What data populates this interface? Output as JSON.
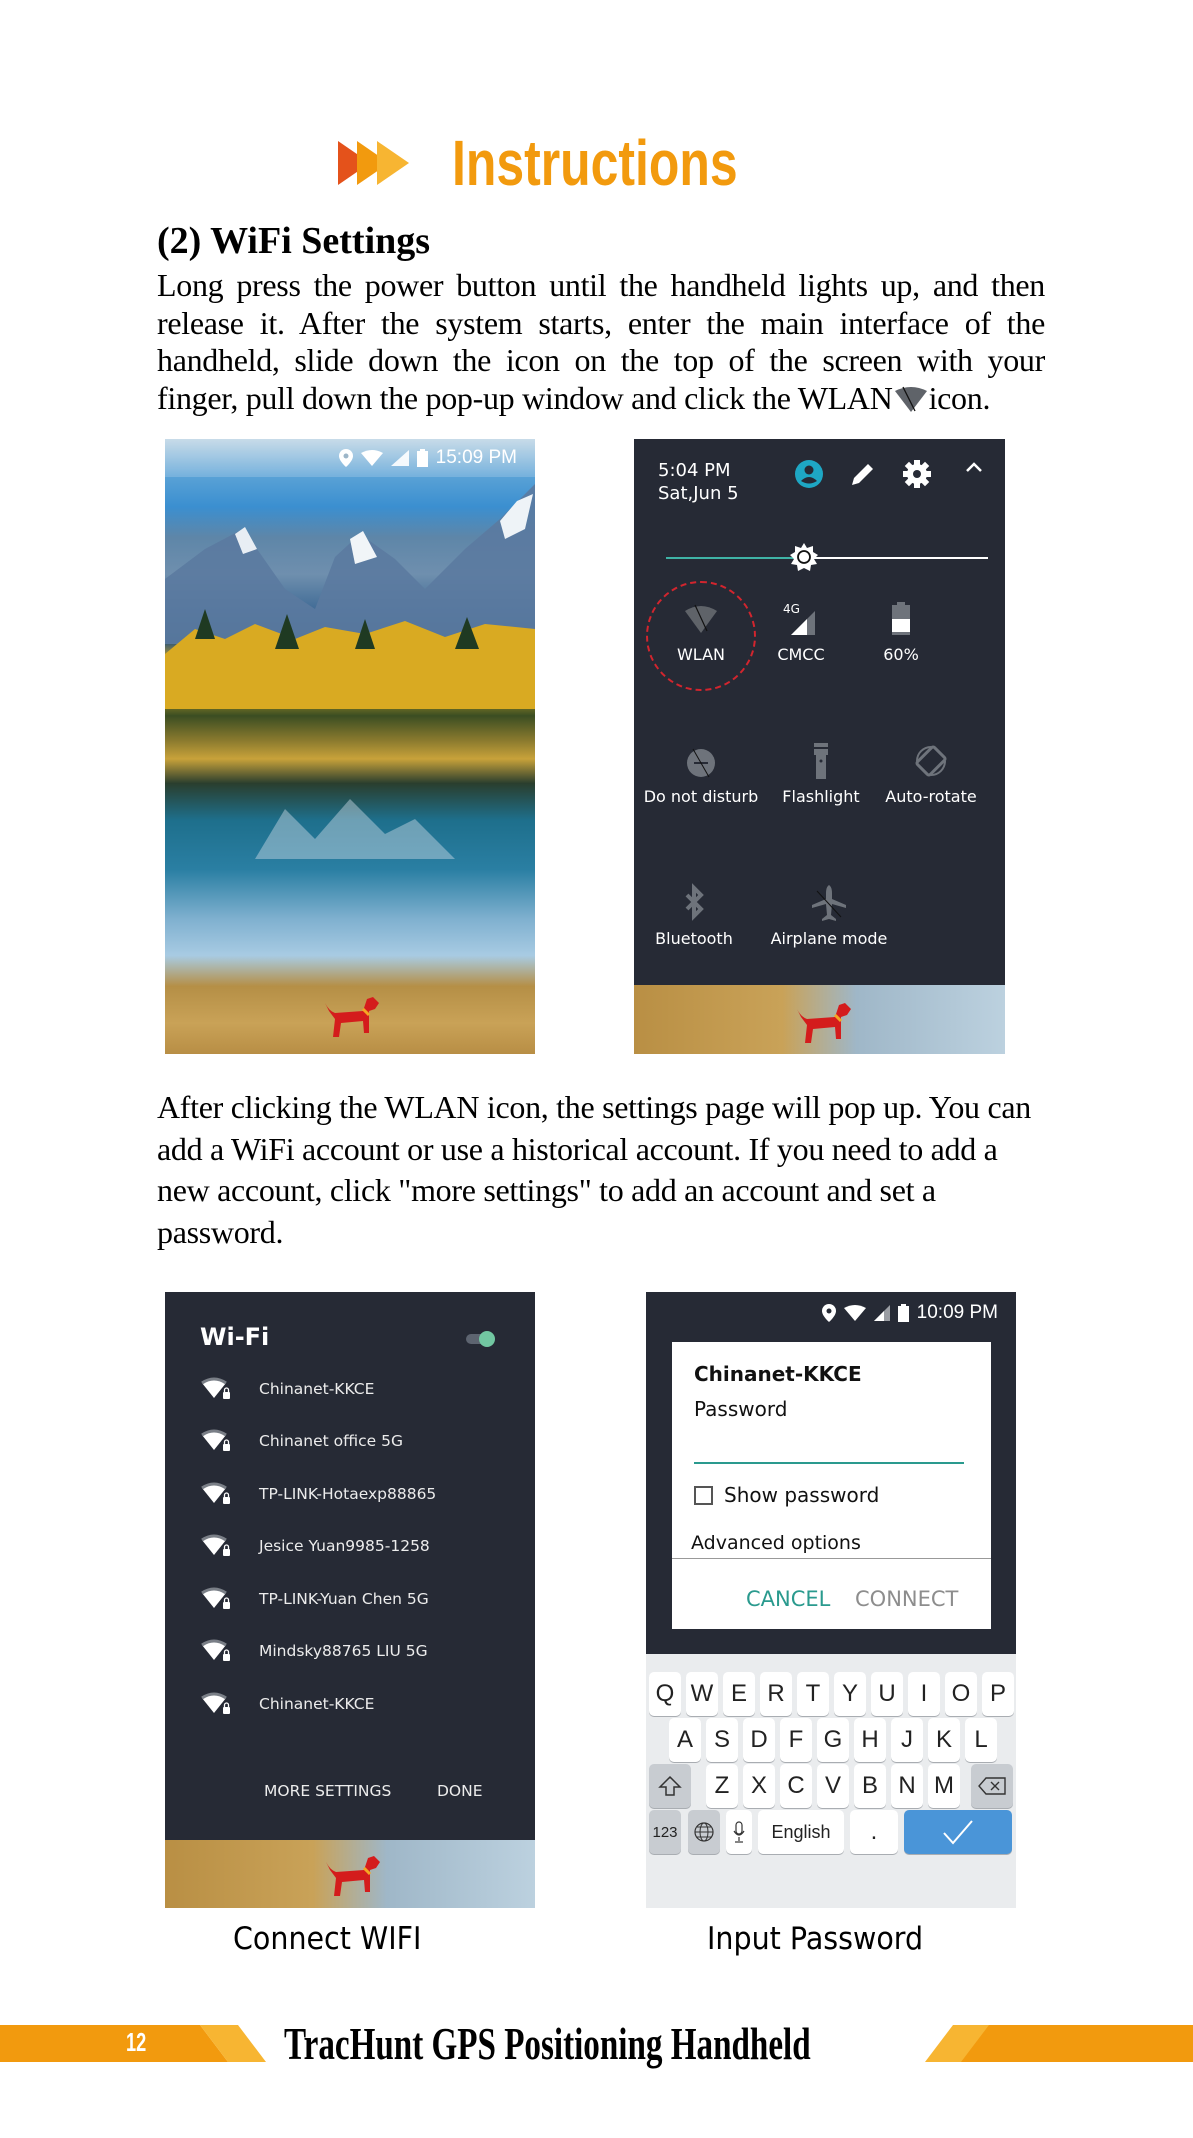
{
  "header": {
    "title": "Instructions",
    "arrow_colors": [
      "#e4521b",
      "#f29a0e",
      "#f7b532"
    ]
  },
  "section": {
    "heading": "(2) WiFi Settings",
    "para1_before_icon": "Long press the power button until the handheld lights up, and then release it. After the system starts, enter the main interface of the handheld, slide down the icon on the top of the screen with your finger, pull down the pop-up window and click the WLAN",
    "para1_icon": "wifi-off-icon",
    "para1_after_icon": "icon.",
    "para2": "After clicking the WLAN icon, the settings page will pop up. You can add a WiFi account or use a historical account. If you need to add a new account, click \"more settings\" to add an account and set a password."
  },
  "home_screen": {
    "status_icons": [
      "location-icon",
      "wifi-icon",
      "signal-icon",
      "battery-icon"
    ],
    "time": "15:09 PM"
  },
  "quick_settings": {
    "time": "5:04 PM",
    "date": "Sat,Jun 5",
    "header_icons": [
      "user-icon",
      "edit-icon",
      "settings-icon",
      "collapse-icon"
    ],
    "brightness_level": 0.43,
    "tiles": [
      {
        "label": "WLAN",
        "icon": "wifi-off-icon",
        "highlighted": true
      },
      {
        "label": "CMCC",
        "icon": "signal-4g-icon",
        "badge": "4G"
      },
      {
        "label": "60%",
        "icon": "battery-icon",
        "level": 0.6
      },
      {
        "label": "Do not disturb",
        "icon": "dnd-icon"
      },
      {
        "label": "Flashlight",
        "icon": "flashlight-icon"
      },
      {
        "label": "Auto-rotate",
        "icon": "rotate-icon"
      },
      {
        "label": "Bluetooth",
        "icon": "bluetooth-icon"
      },
      {
        "label": "Airplane mode",
        "icon": "airplane-icon"
      }
    ]
  },
  "wifi_list": {
    "title": "Wi-Fi",
    "enabled": true,
    "networks": [
      "Chinanet-KKCE",
      "Chinanet office 5G",
      "TP-LINK-Hotaexp88865",
      "Jesice Yuan9985-1258",
      "TP-LINK-Yuan Chen 5G",
      "Mindsky88765 LIU 5G",
      "Chinanet-KKCE"
    ],
    "more_settings": "MORE SETTINGS",
    "done": "DONE"
  },
  "password_dialog": {
    "status_time": "10:09 PM",
    "network": "Chinanet-KKCE",
    "password_label": "Password",
    "password_value": "",
    "show_password": "Show password",
    "show_password_checked": false,
    "advanced": "Advanced options",
    "cancel": "CANCEL",
    "connect": "CONNECT",
    "accent": "#2a9a8e"
  },
  "keyboard": {
    "row1": [
      "Q",
      "W",
      "E",
      "R",
      "T",
      "Y",
      "U",
      "I",
      "O",
      "P"
    ],
    "row2": [
      "A",
      "S",
      "D",
      "F",
      "G",
      "H",
      "J",
      "K",
      "L"
    ],
    "row3": [
      "Z",
      "X",
      "C",
      "V",
      "B",
      "N",
      "M"
    ],
    "numbers": "123",
    "space": "English",
    "period": "."
  },
  "captions": {
    "left": "Connect WIFI",
    "right": "Input Password"
  },
  "footer": {
    "page_number": "12",
    "title": "TracHunt GPS Positioning Handheld",
    "band_color": "#f29a0e"
  }
}
